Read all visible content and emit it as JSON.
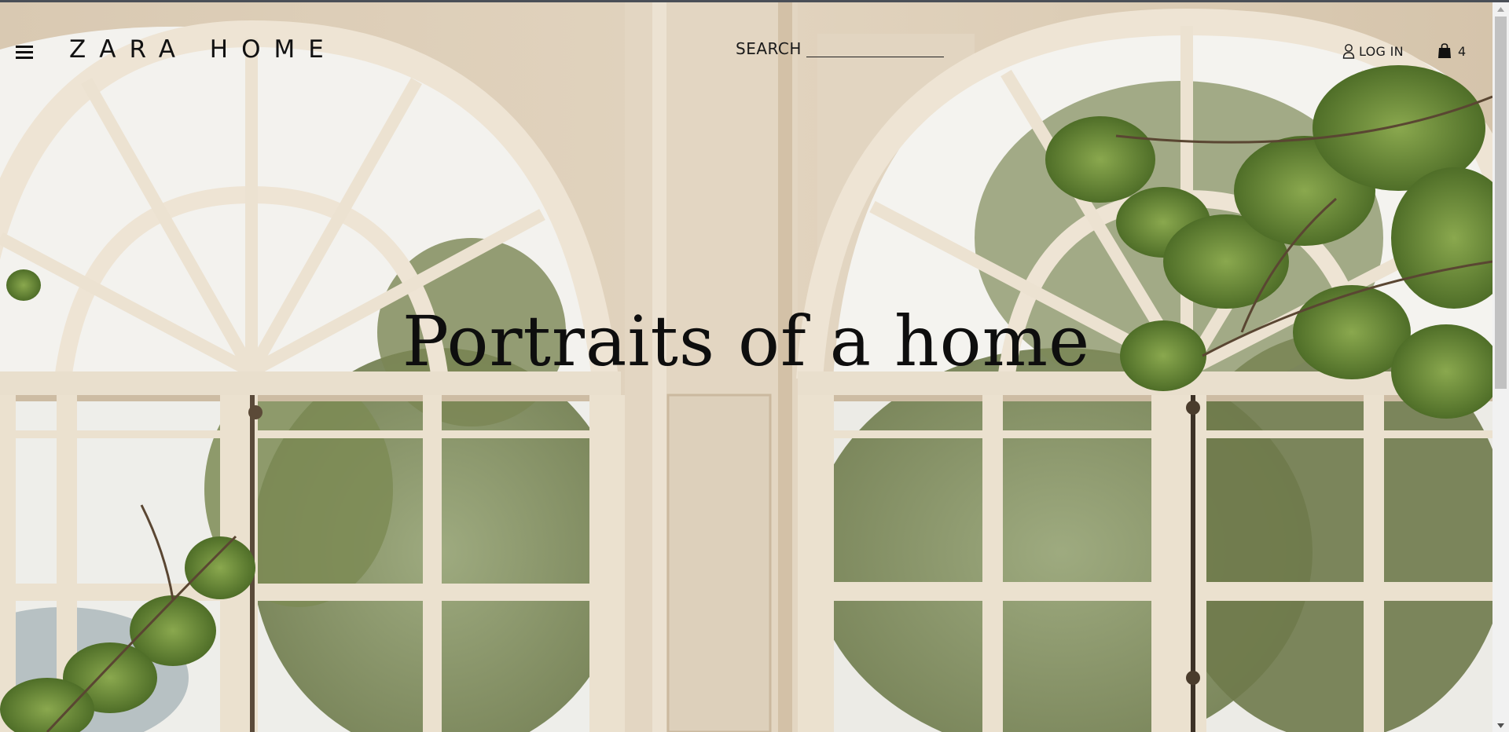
{
  "header": {
    "logo_text": "ZARA HOME",
    "search_label": "SEARCH",
    "login_label": "LOG IN",
    "cart_count": "4"
  },
  "hero": {
    "title": "Portraits of a home"
  },
  "icons": {
    "menu": "hamburger-menu-icon",
    "user": "user-icon",
    "bag": "shopping-bag-icon"
  },
  "colors": {
    "text": "#111111",
    "window_frame": "#efe6d8",
    "wall": "#dccdb8",
    "foliage": "#6f8f3c",
    "sky": "#f4f3ef"
  }
}
